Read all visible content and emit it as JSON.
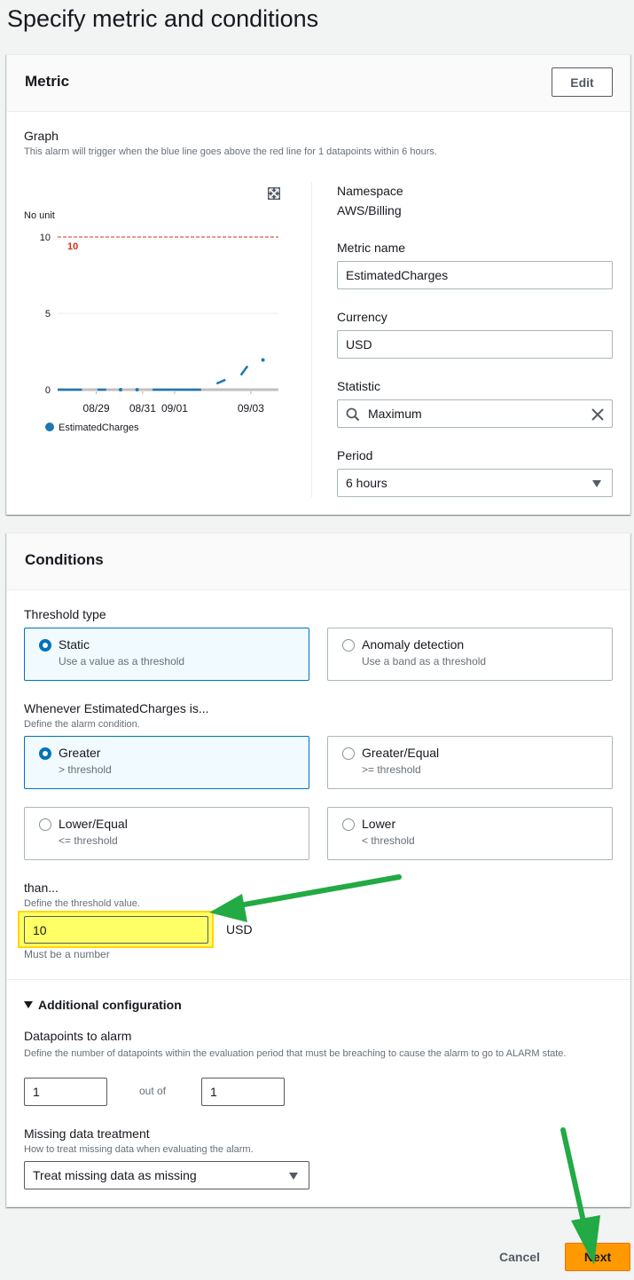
{
  "page": {
    "title": "Specify metric and conditions"
  },
  "metric_panel": {
    "title": "Metric",
    "edit_label": "Edit",
    "graph_label": "Graph",
    "graph_description": "This alarm will trigger when the blue line goes above the red line for 1 datapoints within 6 hours.",
    "expand_icon": "expand-icon",
    "namespace_label": "Namespace",
    "namespace_value": "AWS/Billing",
    "metric_name_label": "Metric name",
    "metric_name_value": "EstimatedCharges",
    "currency_label": "Currency",
    "currency_value": "USD",
    "statistic_label": "Statistic",
    "statistic_value": "Maximum",
    "period_label": "Period",
    "period_value": "6 hours"
  },
  "chart_data": {
    "type": "line",
    "unit_label": "No unit",
    "x_ticks": [
      "08/29",
      "08/31",
      "09/01",
      "09/03"
    ],
    "y_ticks": [
      0,
      5,
      10
    ],
    "ylim": [
      0,
      10
    ],
    "threshold": {
      "value": 10,
      "label": "10",
      "color": "#d13212"
    },
    "series": [
      {
        "name": "EstimatedCharges",
        "color": "#1f77b4",
        "segments": [
          [
            [
              0.0,
              0
            ],
            [
              0.11,
              0
            ]
          ],
          [
            [
              0.18,
              0
            ],
            [
              0.22,
              0
            ]
          ],
          [
            [
              0.285,
              0
            ]
          ],
          [
            [
              0.36,
              0
            ]
          ],
          [
            [
              0.43,
              0
            ],
            [
              0.65,
              0
            ]
          ],
          [
            [
              0.72,
              0.4
            ],
            [
              0.76,
              0.65
            ]
          ],
          [
            [
              0.83,
              0.95
            ],
            [
              0.86,
              1.55
            ]
          ],
          [
            [
              0.93,
              1.95
            ]
          ]
        ]
      }
    ],
    "legend": [
      "EstimatedCharges"
    ],
    "grid": true
  },
  "conditions_panel": {
    "title": "Conditions",
    "threshold_type_label": "Threshold type",
    "threshold_types": [
      {
        "title": "Static",
        "desc": "Use a value as a threshold",
        "selected": true
      },
      {
        "title": "Anomaly detection",
        "desc": "Use a band as a threshold",
        "selected": false
      }
    ],
    "whenever_label": "Whenever EstimatedCharges is...",
    "whenever_desc": "Define the alarm condition.",
    "conditions": [
      {
        "title": "Greater",
        "desc": "> threshold",
        "selected": true
      },
      {
        "title": "Greater/Equal",
        "desc": ">= threshold",
        "selected": false
      },
      {
        "title": "Lower/Equal",
        "desc": "<= threshold",
        "selected": false
      },
      {
        "title": "Lower",
        "desc": "< threshold",
        "selected": false
      }
    ],
    "than_label": "than...",
    "than_desc": "Define the threshold value.",
    "threshold_value": "10",
    "threshold_unit": "USD",
    "threshold_hint": "Must be a number",
    "additional_config_label": "Additional configuration",
    "datapoints_label": "Datapoints to alarm",
    "datapoints_desc": "Define the number of datapoints within the evaluation period that must be breaching to cause the alarm to go to ALARM state.",
    "datapoints_value": "1",
    "out_of_label": "out of",
    "evaluation_value": "1",
    "missing_label": "Missing data treatment",
    "missing_desc": "How to treat missing data when evaluating the alarm.",
    "missing_value": "Treat missing data as missing"
  },
  "footer": {
    "cancel_label": "Cancel",
    "next_label": "Next"
  },
  "annotations": {
    "highlight_color": "#ffff66",
    "arrow_color": "#22aa44"
  }
}
